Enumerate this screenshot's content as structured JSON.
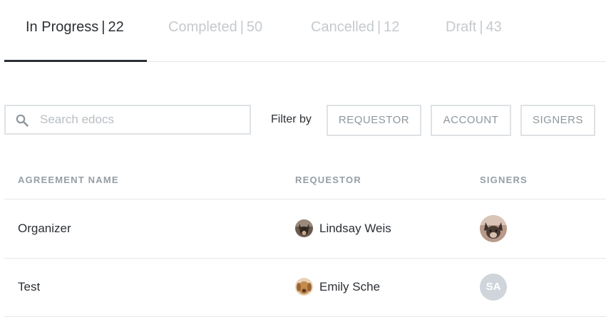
{
  "tabs": [
    {
      "label": "In Progress",
      "count": "22"
    },
    {
      "label": "Completed",
      "count": "50"
    },
    {
      "label": "Cancelled",
      "count": "12"
    },
    {
      "label": "Draft",
      "count": "43"
    }
  ],
  "tab_separator": "|",
  "search": {
    "placeholder": "Search edocs",
    "value": ""
  },
  "filter": {
    "label": "Filter by",
    "buttons": [
      "REQUESTOR",
      "ACCOUNT",
      "SIGNERS"
    ]
  },
  "table": {
    "columns": [
      "AGREEMENT NAME",
      "REQUESTOR",
      "SIGNERS"
    ],
    "rows": [
      {
        "name": "Organizer",
        "requestor": "Lindsay Weis",
        "signer_initials": ""
      },
      {
        "name": "Test",
        "requestor": "Emily Sche",
        "signer_initials": "SA"
      }
    ]
  },
  "colors": {
    "active_tab": "#2b3035",
    "inactive_tab": "#c5cace",
    "border": "#dfe2e5",
    "muted": "#969ea5",
    "initials_bg": "#cfd5da"
  }
}
